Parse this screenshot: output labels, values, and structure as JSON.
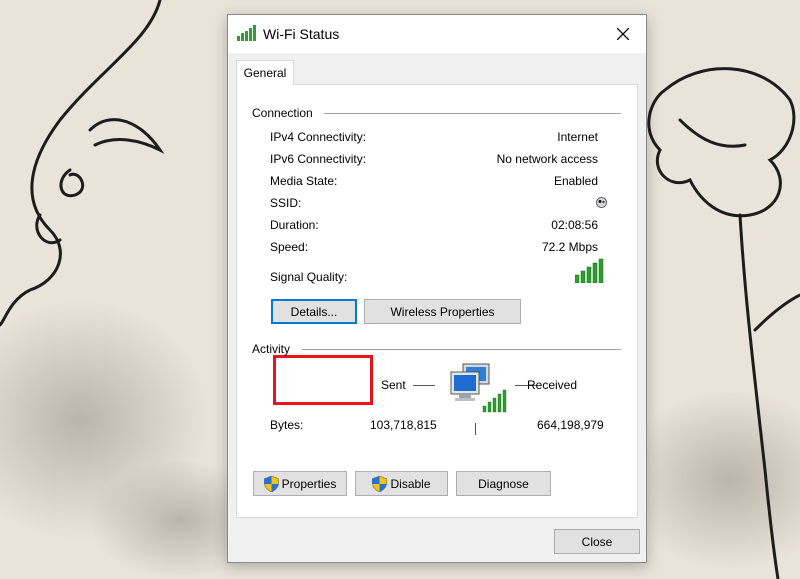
{
  "window": {
    "title": "Wi-Fi Status",
    "close_icon": "close-icon"
  },
  "tabs": [
    {
      "label": "General",
      "selected": true
    }
  ],
  "connection": {
    "heading": "Connection",
    "rows": [
      {
        "label": "IPv4 Connectivity:",
        "value": "Internet"
      },
      {
        "label": "IPv6 Connectivity:",
        "value": "No network access"
      },
      {
        "label": "Media State:",
        "value": "Enabled"
      },
      {
        "label": "SSID:",
        "value": ""
      },
      {
        "label": "Duration:",
        "value": "02:08:56"
      },
      {
        "label": "Speed:",
        "value": "72.2 Mbps"
      }
    ],
    "signal_quality_label": "Signal Quality:",
    "signal_bars": 5,
    "signal_bars_max": 5,
    "details_button": "Details...",
    "wireless_properties_button": "Wireless Properties"
  },
  "activity": {
    "heading": "Activity",
    "sent_label": "Sent",
    "received_label": "Received",
    "bytes_label": "Bytes:",
    "bytes_sent": "103,718,815",
    "bytes_received": "664,198,979"
  },
  "actions": {
    "properties_button": "Properties",
    "disable_button": "Disable",
    "diagnose_button": "Diagnose"
  },
  "footer": {
    "close_button": "Close"
  },
  "colors": {
    "highlight": "#e8141b",
    "signal_green": "#2e9e2e",
    "focus_blue": "#0078d7"
  }
}
